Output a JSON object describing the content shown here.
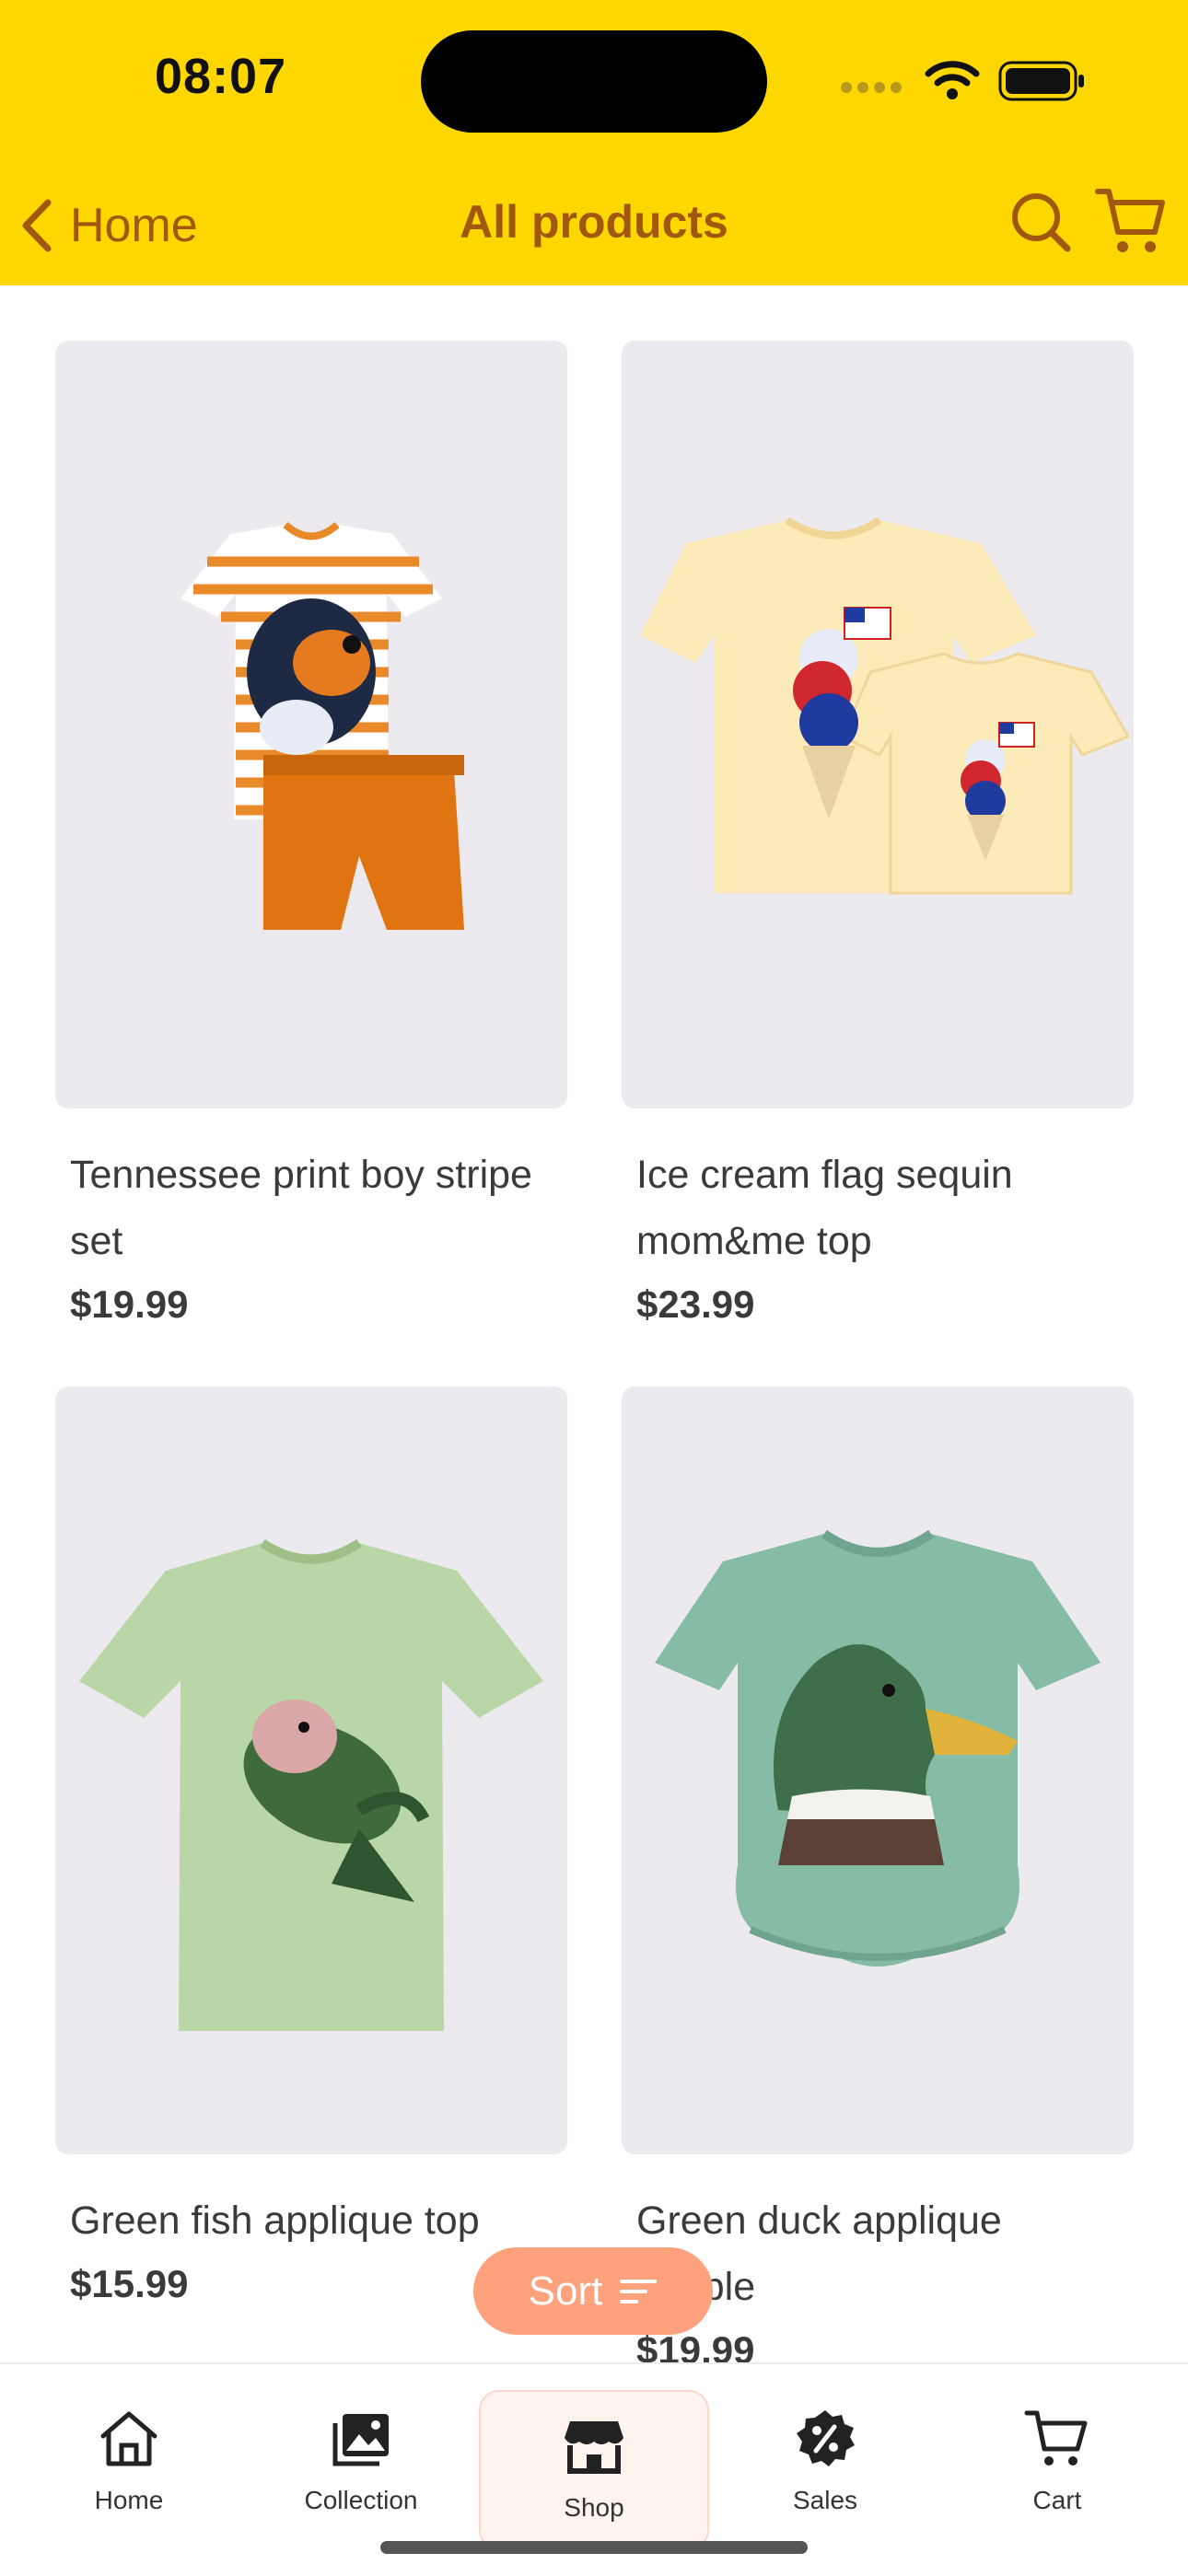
{
  "status_bar": {
    "time": "08:07"
  },
  "nav": {
    "back_label": "Home",
    "title": "All products"
  },
  "products": [
    {
      "name": "Tennessee print boy stripe set",
      "price": "$19.99"
    },
    {
      "name": "Ice cream flag sequin mom&me top",
      "price": "$23.99"
    },
    {
      "name": "Green fish applique top",
      "price": "$15.99"
    },
    {
      "name": "Green duck applique bubble",
      "price": "$19.99"
    }
  ],
  "sort": {
    "label": "Sort"
  },
  "tabs": [
    {
      "label": "Home",
      "icon": "house-icon"
    },
    {
      "label": "Collection",
      "icon": "gallery-icon"
    },
    {
      "label": "Shop",
      "icon": "storefront-icon"
    },
    {
      "label": "Sales",
      "icon": "percent-badge-icon"
    },
    {
      "label": "Cart",
      "icon": "cart-icon"
    }
  ],
  "active_tab": "Shop",
  "colors": {
    "header_bg": "#FFD700",
    "nav_accent": "#A0580E",
    "sort_button": "#FDA27C",
    "active_tab_bg": "#FFF3EE"
  }
}
